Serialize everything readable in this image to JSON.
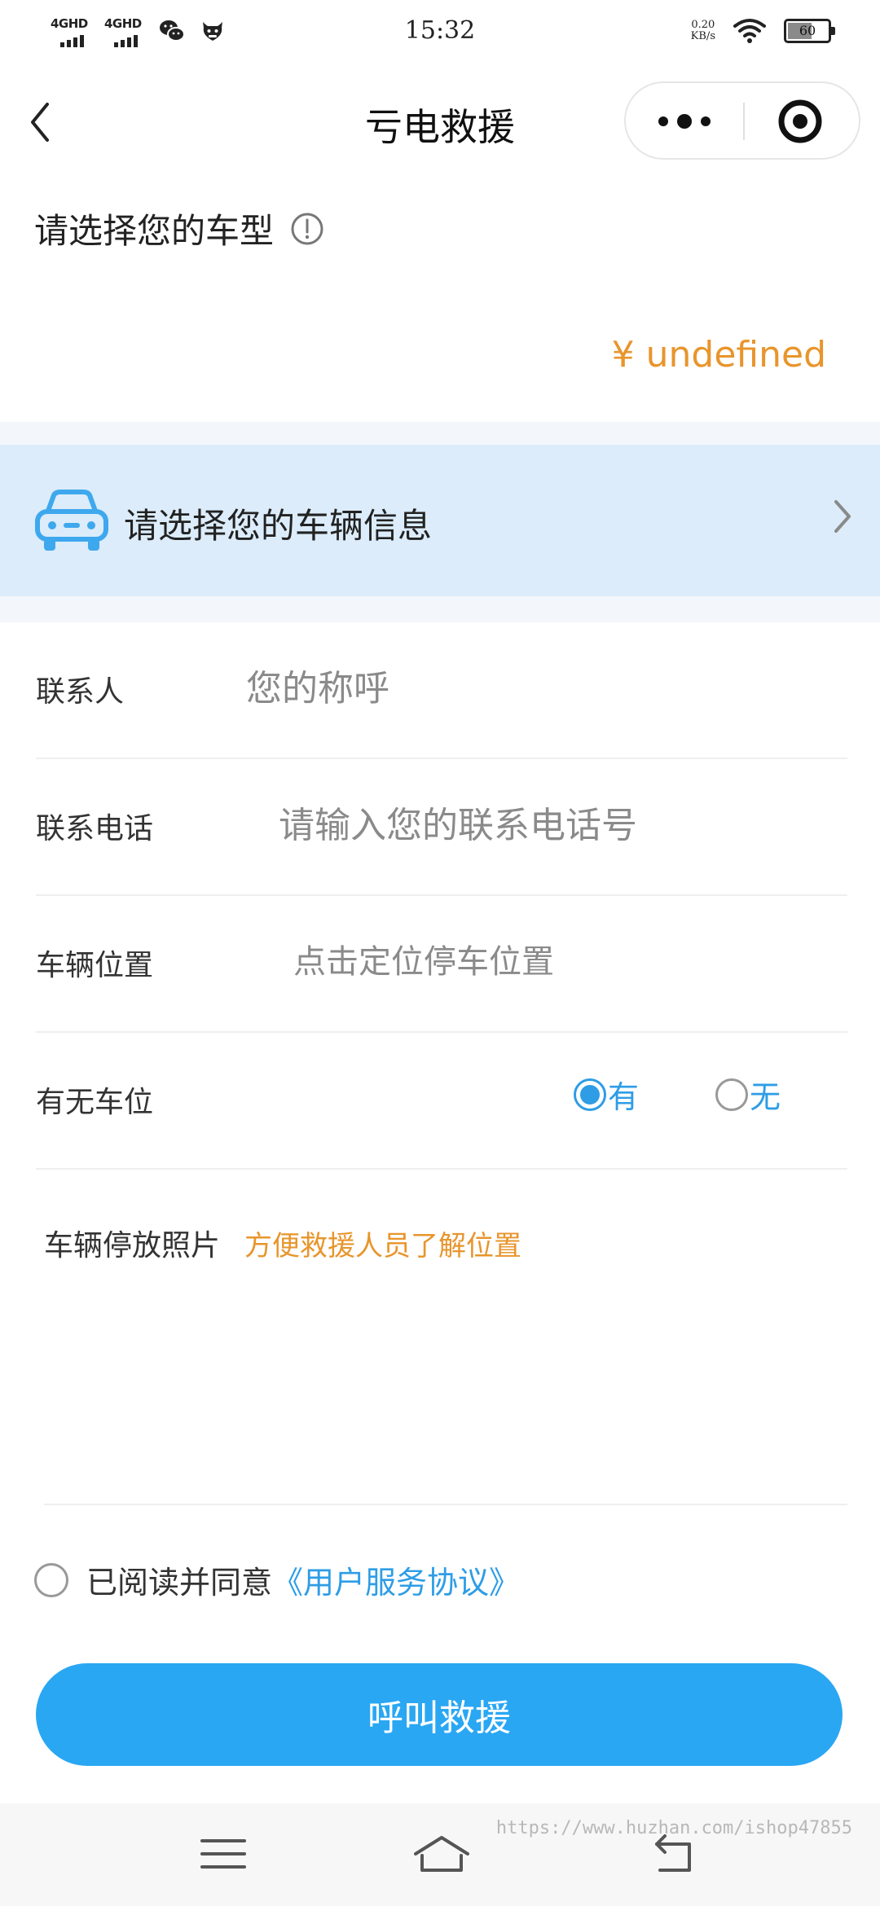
{
  "status_bar": {
    "signal1_label": "4GHD",
    "signal2_label": "4GHD",
    "time": "15:32",
    "net_speed_value": "0.20",
    "net_speed_unit": "KB/s",
    "battery_level": 60,
    "battery_text": "60"
  },
  "nav": {
    "title": "亏电救援"
  },
  "car_type": {
    "label": "请选择您的车型",
    "price": "¥ undefined"
  },
  "vehicle_banner": {
    "label": "请选择您的车辆信息"
  },
  "form": {
    "contact_label": "联系人",
    "contact_placeholder": "您的称呼",
    "phone_label": "联系电话",
    "phone_placeholder": "请输入您的联系电话号",
    "location_label": "车辆位置",
    "location_placeholder": "点击定位停车位置",
    "parking_label": "有无车位",
    "parking_yes": "有",
    "parking_no": "无",
    "parking_selected": "有"
  },
  "photo": {
    "title": "车辆停放照片",
    "hint": "方便救援人员了解位置"
  },
  "agreement": {
    "text": "已阅读并同意",
    "link": "《用户服务协议》"
  },
  "submit": {
    "label": "呼叫救援"
  },
  "watermark": "https://www.huzhan.com/ishop47855",
  "colors": {
    "primary_blue": "#2aa7f3",
    "accent_orange": "#e8952c",
    "banner_bg": "#dcecfa"
  }
}
